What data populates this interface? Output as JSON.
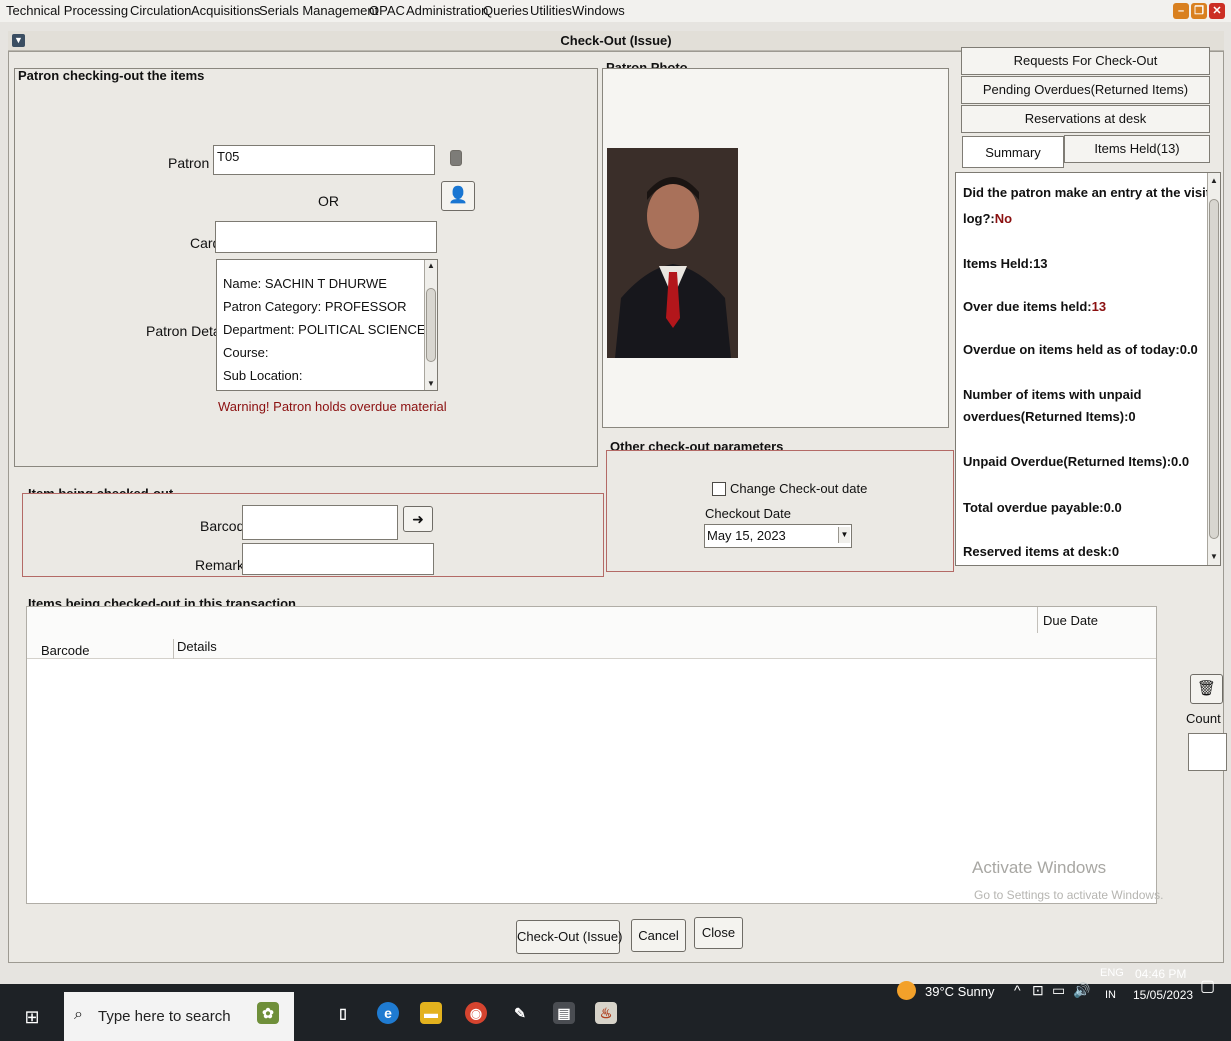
{
  "menubar": {
    "items": [
      "Technical Processing",
      "Circulation",
      "Acquisitions",
      "Serials Management",
      "OPAC",
      "Administration",
      "Queries",
      "Utilities",
      "Windows"
    ]
  },
  "window": {
    "title": "Check-Out (Issue)"
  },
  "patron_panel": {
    "title": "Patron checking-out the items",
    "patron_id_label": "Patron Id",
    "patron_id_value": "T05",
    "or_label": "OR",
    "card_label": "Card",
    "card_value": "",
    "details_label": "Patron Details",
    "details_lines": [
      "Name: SACHIN T DHURWE",
      "Patron Category: PROFESSOR",
      "Department: POLITICAL SCIENCE",
      "Course:",
      "Sub Location:"
    ],
    "warning": "Warning! Patron holds overdue material"
  },
  "photo_panel": {
    "title": "Patron Photo"
  },
  "params_panel": {
    "title": "Other check-out parameters",
    "change_date_label": "Change Check-out date",
    "change_date_checked": false,
    "checkout_date_label": "Checkout Date",
    "checkout_date_value": "May 15, 2023"
  },
  "item_panel": {
    "title": "Item being checked-out",
    "barcode_label": "Barcode",
    "barcode_value": "",
    "remarks_label": "Remarks",
    "remarks_value": ""
  },
  "right_tabs": {
    "requests": "Requests For Check-Out",
    "pending_overdues": "Pending Overdues(Returned Items)",
    "reservations": "Reservations at desk",
    "summary": "Summary",
    "items_held": "Items Held(13)"
  },
  "summary": {
    "visitor_log_q1": "Did the patron make an entry at the visitor",
    "visitor_log_q2": "log?:",
    "visitor_log_answer": "No",
    "items_held": "Items Held:13",
    "overdue_items_label": "Over due items held:",
    "overdue_items_value": "13",
    "overdue_today": "Overdue on items held as of today:0.0",
    "unpaid_count_1": "Number of items with unpaid",
    "unpaid_count_2": "overdues(Returned Items):0",
    "unpaid_overdue": "Unpaid Overdue(Returned Items):0.0",
    "total_payable": "Total overdue payable:0.0",
    "reserved_desk": "Reserved items at desk:0"
  },
  "transaction": {
    "title": "Items being checked-out in this transaction",
    "columns": [
      "Barcode",
      "Details",
      "Due Date"
    ],
    "rows": [],
    "count_label": "Count",
    "count_value": ""
  },
  "buttons": {
    "checkout": "Check-Out (Issue)",
    "cancel": "Cancel",
    "close": "Close"
  },
  "watermark": {
    "line1": "Activate Windows",
    "line2": "Go to Settings to activate Windows."
  },
  "taskbar": {
    "search_placeholder": "Type here to search",
    "weather": "39°C  Sunny",
    "lang1": "ENG",
    "lang2": "IN",
    "time": "04:46 PM",
    "date": "15/05/2023"
  }
}
